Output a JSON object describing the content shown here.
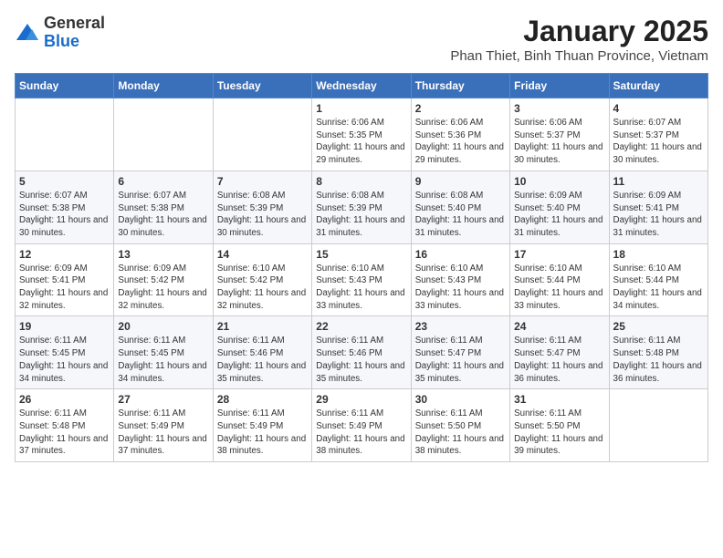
{
  "logo": {
    "general": "General",
    "blue": "Blue"
  },
  "header": {
    "title": "January 2025",
    "subtitle": "Phan Thiet, Binh Thuan Province, Vietnam"
  },
  "days_of_week": [
    "Sunday",
    "Monday",
    "Tuesday",
    "Wednesday",
    "Thursday",
    "Friday",
    "Saturday"
  ],
  "weeks": [
    [
      {
        "day": "",
        "info": ""
      },
      {
        "day": "",
        "info": ""
      },
      {
        "day": "",
        "info": ""
      },
      {
        "day": "1",
        "info": "Sunrise: 6:06 AM\nSunset: 5:35 PM\nDaylight: 11 hours and 29 minutes."
      },
      {
        "day": "2",
        "info": "Sunrise: 6:06 AM\nSunset: 5:36 PM\nDaylight: 11 hours and 29 minutes."
      },
      {
        "day": "3",
        "info": "Sunrise: 6:06 AM\nSunset: 5:37 PM\nDaylight: 11 hours and 30 minutes."
      },
      {
        "day": "4",
        "info": "Sunrise: 6:07 AM\nSunset: 5:37 PM\nDaylight: 11 hours and 30 minutes."
      }
    ],
    [
      {
        "day": "5",
        "info": "Sunrise: 6:07 AM\nSunset: 5:38 PM\nDaylight: 11 hours and 30 minutes."
      },
      {
        "day": "6",
        "info": "Sunrise: 6:07 AM\nSunset: 5:38 PM\nDaylight: 11 hours and 30 minutes."
      },
      {
        "day": "7",
        "info": "Sunrise: 6:08 AM\nSunset: 5:39 PM\nDaylight: 11 hours and 30 minutes."
      },
      {
        "day": "8",
        "info": "Sunrise: 6:08 AM\nSunset: 5:39 PM\nDaylight: 11 hours and 31 minutes."
      },
      {
        "day": "9",
        "info": "Sunrise: 6:08 AM\nSunset: 5:40 PM\nDaylight: 11 hours and 31 minutes."
      },
      {
        "day": "10",
        "info": "Sunrise: 6:09 AM\nSunset: 5:40 PM\nDaylight: 11 hours and 31 minutes."
      },
      {
        "day": "11",
        "info": "Sunrise: 6:09 AM\nSunset: 5:41 PM\nDaylight: 11 hours and 31 minutes."
      }
    ],
    [
      {
        "day": "12",
        "info": "Sunrise: 6:09 AM\nSunset: 5:41 PM\nDaylight: 11 hours and 32 minutes."
      },
      {
        "day": "13",
        "info": "Sunrise: 6:09 AM\nSunset: 5:42 PM\nDaylight: 11 hours and 32 minutes."
      },
      {
        "day": "14",
        "info": "Sunrise: 6:10 AM\nSunset: 5:42 PM\nDaylight: 11 hours and 32 minutes."
      },
      {
        "day": "15",
        "info": "Sunrise: 6:10 AM\nSunset: 5:43 PM\nDaylight: 11 hours and 33 minutes."
      },
      {
        "day": "16",
        "info": "Sunrise: 6:10 AM\nSunset: 5:43 PM\nDaylight: 11 hours and 33 minutes."
      },
      {
        "day": "17",
        "info": "Sunrise: 6:10 AM\nSunset: 5:44 PM\nDaylight: 11 hours and 33 minutes."
      },
      {
        "day": "18",
        "info": "Sunrise: 6:10 AM\nSunset: 5:44 PM\nDaylight: 11 hours and 34 minutes."
      }
    ],
    [
      {
        "day": "19",
        "info": "Sunrise: 6:11 AM\nSunset: 5:45 PM\nDaylight: 11 hours and 34 minutes."
      },
      {
        "day": "20",
        "info": "Sunrise: 6:11 AM\nSunset: 5:45 PM\nDaylight: 11 hours and 34 minutes."
      },
      {
        "day": "21",
        "info": "Sunrise: 6:11 AM\nSunset: 5:46 PM\nDaylight: 11 hours and 35 minutes."
      },
      {
        "day": "22",
        "info": "Sunrise: 6:11 AM\nSunset: 5:46 PM\nDaylight: 11 hours and 35 minutes."
      },
      {
        "day": "23",
        "info": "Sunrise: 6:11 AM\nSunset: 5:47 PM\nDaylight: 11 hours and 35 minutes."
      },
      {
        "day": "24",
        "info": "Sunrise: 6:11 AM\nSunset: 5:47 PM\nDaylight: 11 hours and 36 minutes."
      },
      {
        "day": "25",
        "info": "Sunrise: 6:11 AM\nSunset: 5:48 PM\nDaylight: 11 hours and 36 minutes."
      }
    ],
    [
      {
        "day": "26",
        "info": "Sunrise: 6:11 AM\nSunset: 5:48 PM\nDaylight: 11 hours and 37 minutes."
      },
      {
        "day": "27",
        "info": "Sunrise: 6:11 AM\nSunset: 5:49 PM\nDaylight: 11 hours and 37 minutes."
      },
      {
        "day": "28",
        "info": "Sunrise: 6:11 AM\nSunset: 5:49 PM\nDaylight: 11 hours and 38 minutes."
      },
      {
        "day": "29",
        "info": "Sunrise: 6:11 AM\nSunset: 5:49 PM\nDaylight: 11 hours and 38 minutes."
      },
      {
        "day": "30",
        "info": "Sunrise: 6:11 AM\nSunset: 5:50 PM\nDaylight: 11 hours and 38 minutes."
      },
      {
        "day": "31",
        "info": "Sunrise: 6:11 AM\nSunset: 5:50 PM\nDaylight: 11 hours and 39 minutes."
      },
      {
        "day": "",
        "info": ""
      }
    ]
  ]
}
